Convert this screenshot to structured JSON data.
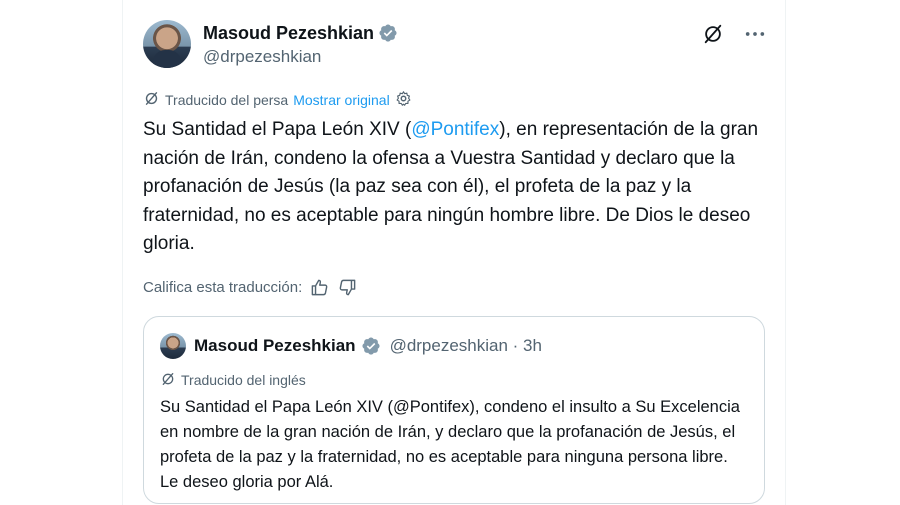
{
  "author": {
    "name": "Masoud Pezeshkian",
    "handle": "@drpezeshkian"
  },
  "translation": {
    "label": "Traducido del persa",
    "show_original": "Mostrar original"
  },
  "tweet": {
    "text_before": "Su Santidad el Papa León XIV (",
    "mention": "@Pontifex",
    "text_after": "), en representación de la gran nación de Irán, condeno la ofensa a Vuestra Santidad y declaro que la profanación de Jesús (la paz sea con él), el profeta de la paz y la fraternidad, no es aceptable para ningún hombre libre. De Dios le deseo gloria."
  },
  "rating": {
    "label": "Califica esta traducción:"
  },
  "quote": {
    "name": "Masoud Pezeshkian",
    "handle_time": "@drpezeshkian · 3h",
    "translated_label": "Traducido del inglés",
    "text": "Su Santidad el Papa León XIV (@Pontifex), condeno el insulto a Su Excelencia en nombre de la gran nación de Irán, y declaro que la profanación de Jesús, el profeta de la paz y la fraternidad, no es aceptable para ninguna persona libre. Le deseo gloria por Alá."
  },
  "icons": {
    "verified": "verified-badge-icon",
    "grok": "grok-icon",
    "more": "more-icon",
    "translate": "translate-icon",
    "settings": "settings-icon",
    "thumbs_up": "thumbs-up-icon",
    "thumbs_down": "thumbs-down-icon"
  },
  "colors": {
    "link": "#1d9bf0",
    "secondary_text": "#536471",
    "primary_text": "#0f1419",
    "border": "#cfd9de",
    "verified": "#829aab"
  }
}
